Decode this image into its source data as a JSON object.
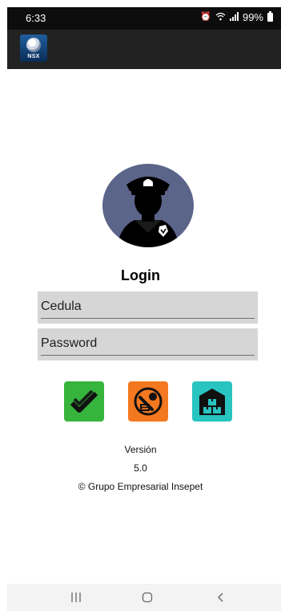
{
  "status_bar": {
    "time": "6:33",
    "battery": "99%",
    "icons": [
      "alarm-icon",
      "wifi-icon",
      "signal-icon",
      "battery-icon"
    ]
  },
  "app_bar": {
    "logo_text": "NSX"
  },
  "login": {
    "title": "Login",
    "cedula_placeholder": "Cedula",
    "password_placeholder": "Password"
  },
  "actions": [
    {
      "icon": "double-check-icon",
      "color": "#36b43c"
    },
    {
      "icon": "tools-icon",
      "color": "#f4781f"
    },
    {
      "icon": "warehouse-icon",
      "color": "#27c4c0"
    }
  ],
  "footer": {
    "version_label": "Versión",
    "version_number": "5.0",
    "copyright": "© Grupo Empresarial Insepet"
  },
  "nav_bar": {
    "icons": [
      "recent-apps-icon",
      "home-icon",
      "back-icon"
    ]
  },
  "colors": {
    "status_bar": "#0d0d0d",
    "app_bar": "#222222",
    "avatar_bg": "#5b6489",
    "field_bg": "#d6d6d6"
  }
}
